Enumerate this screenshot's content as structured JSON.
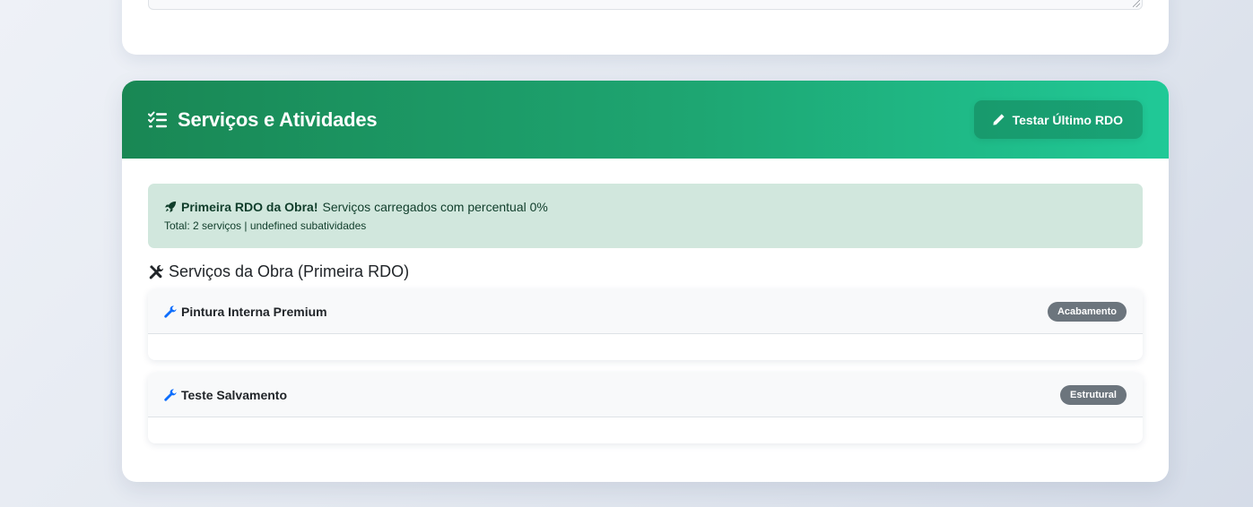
{
  "header": {
    "title": "Serviços e Atividades",
    "test_button_label": "Testar Último RDO",
    "title_icon": "list-check-icon",
    "button_icon": "pencil-icon"
  },
  "alert": {
    "title": "Primeira RDO da Obra!",
    "message": "Serviços carregados com percentual 0%",
    "summary": "Total: 2 serviços | undefined subatividades",
    "icon": "rocket-icon"
  },
  "services_section": {
    "title": "Serviços da Obra (Primeira RDO)",
    "icon": "tools-icon",
    "items": [
      {
        "name": "Pintura Interna Premium",
        "category": "Acabamento",
        "icon": "wrench-icon"
      },
      {
        "name": "Teste Salvamento",
        "category": "Estrutural",
        "icon": "wrench-icon"
      }
    ]
  },
  "colors": {
    "header_gradient_start": "#198754",
    "header_gradient_end": "#20c997",
    "alert_background": "#d1e7dd",
    "badge_background": "#6c757d",
    "wrench_icon": "#0d6efd"
  }
}
